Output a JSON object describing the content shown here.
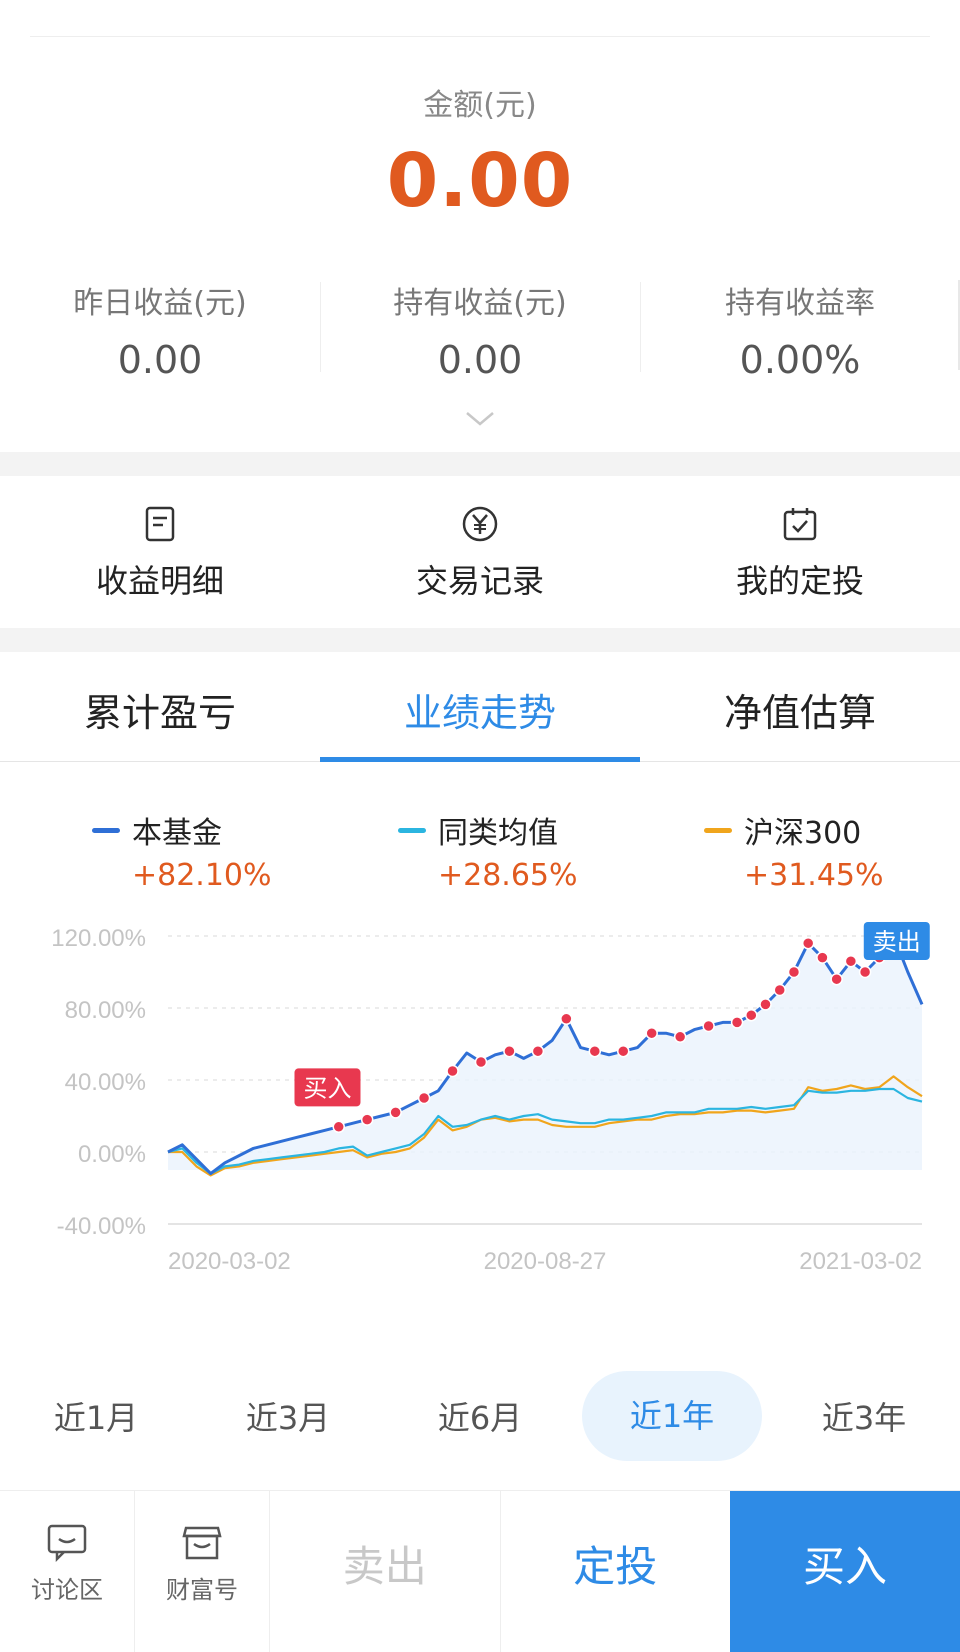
{
  "summary": {
    "amount_label": "金额(元)",
    "amount_value": "0.00",
    "stats": [
      {
        "label": "昨日收益(元)",
        "value": "0.00"
      },
      {
        "label": "持有收益(元)",
        "value": "0.00"
      },
      {
        "label": "持有收益率",
        "value": "0.00%"
      }
    ]
  },
  "shortcuts": [
    {
      "label": "收益明细",
      "icon": "document-icon"
    },
    {
      "label": "交易记录",
      "icon": "yen-circle-icon"
    },
    {
      "label": "我的定投",
      "icon": "calendar-check-icon"
    }
  ],
  "tabs": [
    {
      "label": "累计盈亏",
      "active": false
    },
    {
      "label": "业绩走势",
      "active": true
    },
    {
      "label": "净值估算",
      "active": false
    }
  ],
  "legend": [
    {
      "name": "本基金",
      "value": "+82.10%",
      "color": "#2f6fd6"
    },
    {
      "name": "同类均值",
      "value": "+28.65%",
      "color": "#2bb5e0"
    },
    {
      "name": "沪深300",
      "value": "+31.45%",
      "color": "#f0a51c"
    }
  ],
  "chart_data": {
    "type": "line",
    "ylim": [
      -40,
      120
    ],
    "y_ticks": [
      "120.00%",
      "80.00%",
      "40.00%",
      "0.00%",
      "-40.00%"
    ],
    "y_tick_values": [
      120,
      80,
      40,
      0,
      -40
    ],
    "x_ticks": [
      "2020-03-02",
      "2020-08-27",
      "2021-03-02"
    ],
    "grid": true,
    "markers": [
      {
        "label": "买入",
        "color": "#e8384f"
      },
      {
        "label": "卖出",
        "color": "#2e8be6"
      }
    ],
    "series": [
      {
        "name": "本基金",
        "color": "#2f6fd6",
        "values": [
          0,
          4,
          -4,
          -12,
          -6,
          -2,
          2,
          4,
          6,
          8,
          10,
          12,
          14,
          16,
          18,
          20,
          22,
          26,
          30,
          34,
          45,
          55,
          50,
          54,
          56,
          52,
          56,
          62,
          74,
          58,
          56,
          54,
          56,
          58,
          66,
          66,
          64,
          68,
          70,
          72,
          72,
          76,
          82,
          90,
          100,
          116,
          108,
          96,
          106,
          100,
          108,
          120,
          100,
          82
        ]
      },
      {
        "name": "同类均值",
        "color": "#2bb5e0",
        "values": [
          0,
          2,
          -6,
          -12,
          -8,
          -7,
          -5,
          -4,
          -3,
          -2,
          -1,
          0,
          2,
          3,
          -2,
          0,
          2,
          4,
          10,
          20,
          14,
          15,
          18,
          20,
          18,
          20,
          21,
          18,
          17,
          16,
          16,
          18,
          18,
          19,
          20,
          22,
          22,
          22,
          24,
          24,
          24,
          25,
          24,
          25,
          26,
          34,
          33,
          33,
          34,
          34,
          35,
          35,
          30,
          28
        ]
      },
      {
        "name": "沪深300",
        "color": "#f0a51c",
        "values": [
          0,
          0,
          -8,
          -13,
          -9,
          -8,
          -6,
          -5,
          -4,
          -3,
          -2,
          -1,
          0,
          1,
          -3,
          -1,
          0,
          2,
          8,
          18,
          12,
          14,
          18,
          19,
          17,
          18,
          18,
          15,
          14,
          14,
          14,
          16,
          17,
          18,
          18,
          20,
          21,
          21,
          22,
          22,
          23,
          23,
          22,
          23,
          24,
          36,
          34,
          35,
          37,
          35,
          36,
          42,
          36,
          31
        ]
      }
    ]
  },
  "ranges": [
    {
      "label": "近1月",
      "active": false
    },
    {
      "label": "近3月",
      "active": false
    },
    {
      "label": "近6月",
      "active": false
    },
    {
      "label": "近1年",
      "active": true
    },
    {
      "label": "近3年",
      "active": false
    }
  ],
  "bottom_bar": {
    "discussion_label": "讨论区",
    "wealth_label": "财富号",
    "sell_label": "卖出",
    "fixed_label": "定投",
    "buy_label": "买入"
  }
}
